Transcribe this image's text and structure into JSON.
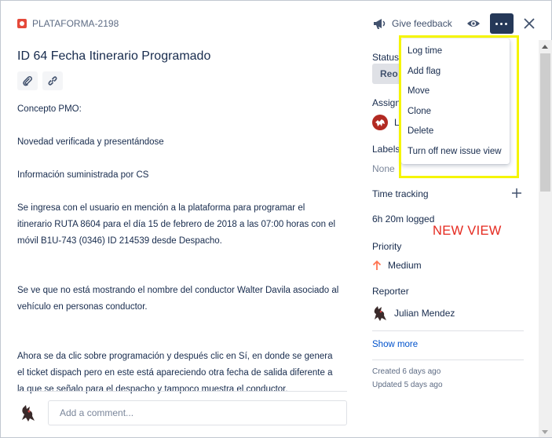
{
  "header": {
    "issue_key": "PLATAFORMA-2198",
    "feedback_label": "Give feedback"
  },
  "issue": {
    "title": "ID 64 Fecha Itinerario Programado",
    "description": [
      "Concepto PMO:",
      "",
      "Novedad verificada y presentándose",
      "",
      "Información suministrada por CS",
      "",
      "Se ingresa con el usuario en mención a la plataforma para programar el itinerario RUTA 8604 para el día 15 de febrero de 2018 a las 07:00 horas con el móvil B1U-743 (0346) ID 214539 desde Despacho.",
      "",
      "",
      "Se ve que no está mostrando el nombre del conductor Walter Davila asociado al vehículo en personas conductor.",
      "",
      "",
      "Ahora se da clic sobre programación y después clic en Sí, en donde se genera el ticket dispach pero en este está apareciendo otra fecha de salida diferente a la que se señalo para el despacho y tampoco muestra el conductor."
    ],
    "comment_placeholder": "Add a comment..."
  },
  "sidebar": {
    "status_label": "Status",
    "status_value": "Reo",
    "assignee_label": "Assign",
    "assignee_initial": "L",
    "labels_label": "Labels",
    "labels_value": "None",
    "time_tracking_label": "Time tracking",
    "time_logged": "6h 20m logged",
    "priority_label": "Priority",
    "priority_value": "Medium",
    "reporter_label": "Reporter",
    "reporter_name": "Julian Mendez",
    "show_more": "Show more",
    "created": "Created 6 days ago",
    "updated": "Updated 5 days ago"
  },
  "annotation": {
    "text": "NEW VIEW",
    "color": "#e5291f",
    "highlight_color": "#f5f500"
  },
  "menu": {
    "items": [
      {
        "label": "Log time"
      },
      {
        "label": "Add flag"
      },
      {
        "label": "Move"
      },
      {
        "label": "Clone"
      },
      {
        "label": "Delete"
      },
      {
        "label": "Turn off new issue view"
      }
    ]
  },
  "colors": {
    "bug": "#e5493a",
    "priority_medium": "#ff7452",
    "link": "#0052cc",
    "more_button": "#253858"
  }
}
